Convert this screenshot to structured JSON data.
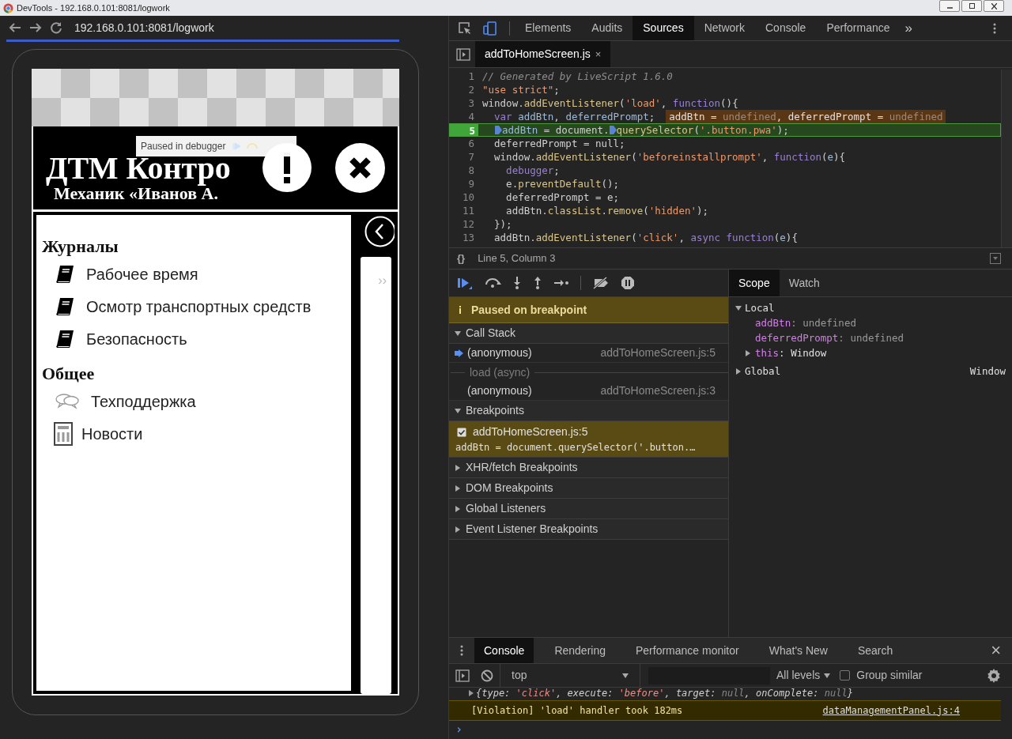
{
  "window": {
    "title": "DevTools - 192.168.0.101:8081/logwork"
  },
  "browser": {
    "url": "192.168.0.101:8081/logwork"
  },
  "app": {
    "title": "ДТМ Контро",
    "subtitle": "Механик «Иванов А.",
    "paused_overlay": "Paused in debugger",
    "side_panel": {
      "expand": "››"
    },
    "sections": [
      {
        "heading": "Журналы",
        "items": [
          {
            "label": "Рабочее время",
            "kind": "book"
          },
          {
            "label": "Осмотр транспортных средств",
            "kind": "book"
          },
          {
            "label": "Безопасность",
            "kind": "book"
          }
        ]
      },
      {
        "heading": "Общее",
        "items": [
          {
            "label": "Техподдержка",
            "kind": "chat"
          },
          {
            "label": "Новости",
            "kind": "news"
          }
        ]
      }
    ]
  },
  "devtools": {
    "tabs": [
      {
        "label": "Elements",
        "selected": false
      },
      {
        "label": "Audits",
        "selected": false
      },
      {
        "label": "Sources",
        "selected": true
      },
      {
        "label": "Network",
        "selected": false
      },
      {
        "label": "Console",
        "selected": false
      },
      {
        "label": "Performance",
        "selected": false
      }
    ],
    "more_tabs": "»",
    "file_tabs": [
      {
        "label": "addToHomeScreen.js",
        "selected": true,
        "close": "×"
      }
    ],
    "editor": {
      "lines": [
        {
          "number": "1",
          "current": false,
          "tokens": [
            {
              "kind": "comment",
              "text": "// Generated by LiveScript 1.6.0"
            }
          ]
        },
        {
          "number": "2",
          "current": false,
          "tokens": [
            {
              "kind": "string",
              "text": "\"use strict\""
            },
            {
              "kind": "plain",
              "text": ";"
            }
          ]
        },
        {
          "number": "3",
          "current": false,
          "tokens": [
            {
              "kind": "plain",
              "text": "window."
            },
            {
              "kind": "method",
              "text": "addEventListener"
            },
            {
              "kind": "plain",
              "text": "("
            },
            {
              "kind": "string",
              "text": "'load'"
            },
            {
              "kind": "plain",
              "text": ", "
            },
            {
              "kind": "keyword",
              "text": "function"
            },
            {
              "kind": "plain",
              "text": "(){"
            }
          ]
        },
        {
          "number": "4",
          "current": false,
          "tokens": [
            {
              "kind": "keyword",
              "text": "  var"
            },
            {
              "kind": "variable",
              "text": " addBtn"
            },
            {
              "kind": "plain",
              "text": ", "
            },
            {
              "kind": "variable",
              "text": "deferredPrompt"
            },
            {
              "kind": "plain",
              "text": ";"
            }
          ],
          "inline": [
            {
              "kind": "name",
              "text": "addBtn = "
            },
            {
              "kind": "value",
              "text": "undefined"
            },
            {
              "kind": "name",
              "text": ", deferredPrompt = "
            },
            {
              "kind": "value",
              "text": "undefined"
            }
          ]
        },
        {
          "number": "5",
          "current": true,
          "tokens": [
            {
              "kind": "variable",
              "text": "  addBtn",
              "marker": true
            },
            {
              "kind": "plain",
              "text": " = document."
            },
            {
              "kind": "method",
              "text": "querySelector",
              "marker": true
            },
            {
              "kind": "plain",
              "text": "("
            },
            {
              "kind": "string",
              "text": "'.button.pwa'"
            },
            {
              "kind": "plain",
              "text": ");"
            }
          ]
        },
        {
          "number": "6",
          "current": false,
          "tokens": [
            {
              "kind": "plain",
              "text": "  deferredPrompt = null;"
            }
          ]
        },
        {
          "number": "7",
          "current": false,
          "tokens": [
            {
              "kind": "plain",
              "text": "  window."
            },
            {
              "kind": "method",
              "text": "addEventListener"
            },
            {
              "kind": "plain",
              "text": "("
            },
            {
              "kind": "string",
              "text": "'beforeinstallprompt'"
            },
            {
              "kind": "plain",
              "text": ", "
            },
            {
              "kind": "keyword",
              "text": "function"
            },
            {
              "kind": "plain",
              "text": "("
            },
            {
              "kind": "variable",
              "text": "e"
            },
            {
              "kind": "plain",
              "text": "){"
            }
          ]
        },
        {
          "number": "8",
          "current": false,
          "tokens": [
            {
              "kind": "keyword",
              "text": "    debugger"
            },
            {
              "kind": "plain",
              "text": ";"
            }
          ]
        },
        {
          "number": "9",
          "current": false,
          "tokens": [
            {
              "kind": "plain",
              "text": "    e."
            },
            {
              "kind": "method",
              "text": "preventDefault"
            },
            {
              "kind": "plain",
              "text": "();"
            }
          ]
        },
        {
          "number": "10",
          "current": false,
          "tokens": [
            {
              "kind": "plain",
              "text": "    deferredPrompt = e;"
            }
          ]
        },
        {
          "number": "11",
          "current": false,
          "tokens": [
            {
              "kind": "plain",
              "text": "    addBtn."
            },
            {
              "kind": "method",
              "text": "classList"
            },
            {
              "kind": "plain",
              "text": "."
            },
            {
              "kind": "method",
              "text": "remove"
            },
            {
              "kind": "plain",
              "text": "("
            },
            {
              "kind": "string",
              "text": "'hidden'"
            },
            {
              "kind": "plain",
              "text": ");"
            }
          ]
        },
        {
          "number": "12",
          "current": false,
          "tokens": [
            {
              "kind": "plain",
              "text": "  });"
            }
          ]
        },
        {
          "number": "13",
          "current": false,
          "tokens": [
            {
              "kind": "plain",
              "text": "  addBtn."
            },
            {
              "kind": "method",
              "text": "addEventListener"
            },
            {
              "kind": "plain",
              "text": "("
            },
            {
              "kind": "string",
              "text": "'click'"
            },
            {
              "kind": "plain",
              "text": ", "
            },
            {
              "kind": "keyword",
              "text": "async function"
            },
            {
              "kind": "plain",
              "text": "("
            },
            {
              "kind": "variable",
              "text": "e"
            },
            {
              "kind": "plain",
              "text": "){"
            }
          ]
        }
      ]
    },
    "status": {
      "format": "{}",
      "position": "Line 5, Column 3"
    }
  },
  "debugger": {
    "paused_message": "Paused on breakpoint",
    "call_stack": {
      "title": "Call Stack",
      "expanded": true,
      "frames": [
        {
          "kind": "frame",
          "name": "(anonymous)",
          "location": "addToHomeScreen.js:5",
          "current": true
        },
        {
          "kind": "async",
          "name": "load (async)"
        },
        {
          "kind": "frame",
          "name": "(anonymous)",
          "location": "addToHomeScreen.js:3",
          "current": false
        }
      ]
    },
    "breakpoints": {
      "title": "Breakpoints",
      "expanded": true,
      "items": [
        {
          "location": "addToHomeScreen.js:5",
          "code": "addBtn = document.querySelector('.button.…",
          "checked": true
        }
      ]
    },
    "sections": [
      {
        "title": "XHR/fetch Breakpoints",
        "expanded": false
      },
      {
        "title": "DOM Breakpoints",
        "expanded": false
      },
      {
        "title": "Global Listeners",
        "expanded": false
      },
      {
        "title": "Event Listener Breakpoints",
        "expanded": false
      }
    ]
  },
  "sidebar": {
    "tabs": [
      {
        "label": "Scope",
        "selected": true
      },
      {
        "label": "Watch",
        "selected": false
      }
    ],
    "scopes": [
      {
        "title": "Local",
        "expanded": true,
        "items": [
          {
            "kind": "value",
            "name": "addBtn",
            "value": ": undefined"
          },
          {
            "kind": "value",
            "name": "deferredPrompt",
            "value": ": undefined"
          },
          {
            "kind": "object",
            "name": "this",
            "value": ": Window",
            "expanded": false
          }
        ]
      },
      {
        "title": "Global",
        "expanded": false,
        "value": "Window"
      }
    ]
  },
  "drawer": {
    "tabs": [
      {
        "label": "Console",
        "selected": true
      },
      {
        "label": "Rendering",
        "selected": false
      },
      {
        "label": "Performance monitor",
        "selected": false
      },
      {
        "label": "What's New",
        "selected": false
      },
      {
        "label": "Search",
        "selected": false
      }
    ],
    "close": "×",
    "context": "top",
    "levels": "All levels",
    "group_similar": {
      "label": "Group similar",
      "checked": false
    },
    "messages": [
      {
        "kind": "object",
        "expanded": false,
        "tokens": [
          {
            "kind": "plain",
            "text": "{type: "
          },
          {
            "kind": "string",
            "text": "'click'"
          },
          {
            "kind": "plain",
            "text": ", execute: "
          },
          {
            "kind": "string",
            "text": "'before'"
          },
          {
            "kind": "plain",
            "text": ", target: "
          },
          {
            "kind": "null",
            "text": "null"
          },
          {
            "kind": "plain",
            "text": ", onComplete: "
          },
          {
            "kind": "null",
            "text": "null"
          },
          {
            "kind": "plain",
            "text": "}"
          }
        ]
      },
      {
        "kind": "violation",
        "text": "[Violation] 'load' handler took 182ms",
        "source": "dataManagementPanel.js:4"
      }
    ],
    "prompt": "›"
  }
}
